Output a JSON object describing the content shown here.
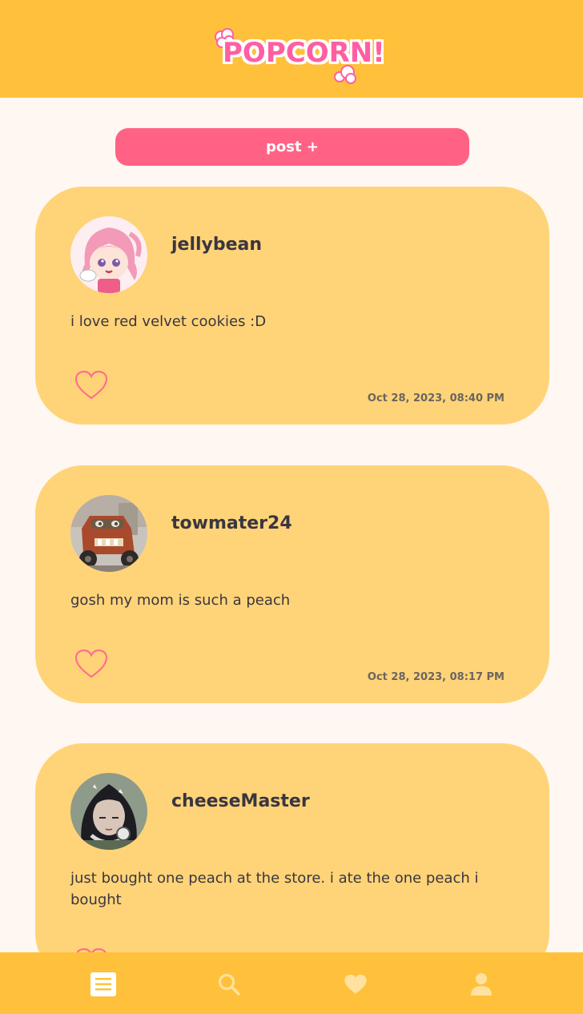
{
  "app": {
    "logo_text": "POPCORN!",
    "brand_color": "#ffc13b",
    "accent_color": "#ff6285"
  },
  "actions": {
    "post_label": "post +"
  },
  "posts": [
    {
      "username": "jellybean",
      "text": "i love red velvet cookies :D",
      "timestamp": "Oct 28, 2023, 08:40 PM",
      "avatar_icon": "anime-girl-avatar",
      "liked": false
    },
    {
      "username": "towmater24",
      "text": "gosh my mom is such a peach",
      "timestamp": "Oct 28, 2023, 08:17 PM",
      "avatar_icon": "tow-truck-avatar",
      "liked": false
    },
    {
      "username": "cheeseMaster",
      "text": "just bought one peach at the store. i ate the one peach i bought",
      "avatar_icon": "headphones-girl-avatar",
      "liked": false
    }
  ],
  "nav": {
    "items": [
      {
        "icon": "feed-icon",
        "active": true
      },
      {
        "icon": "search-icon",
        "active": false
      },
      {
        "icon": "heart-icon",
        "active": false
      },
      {
        "icon": "profile-icon",
        "active": false
      }
    ]
  }
}
